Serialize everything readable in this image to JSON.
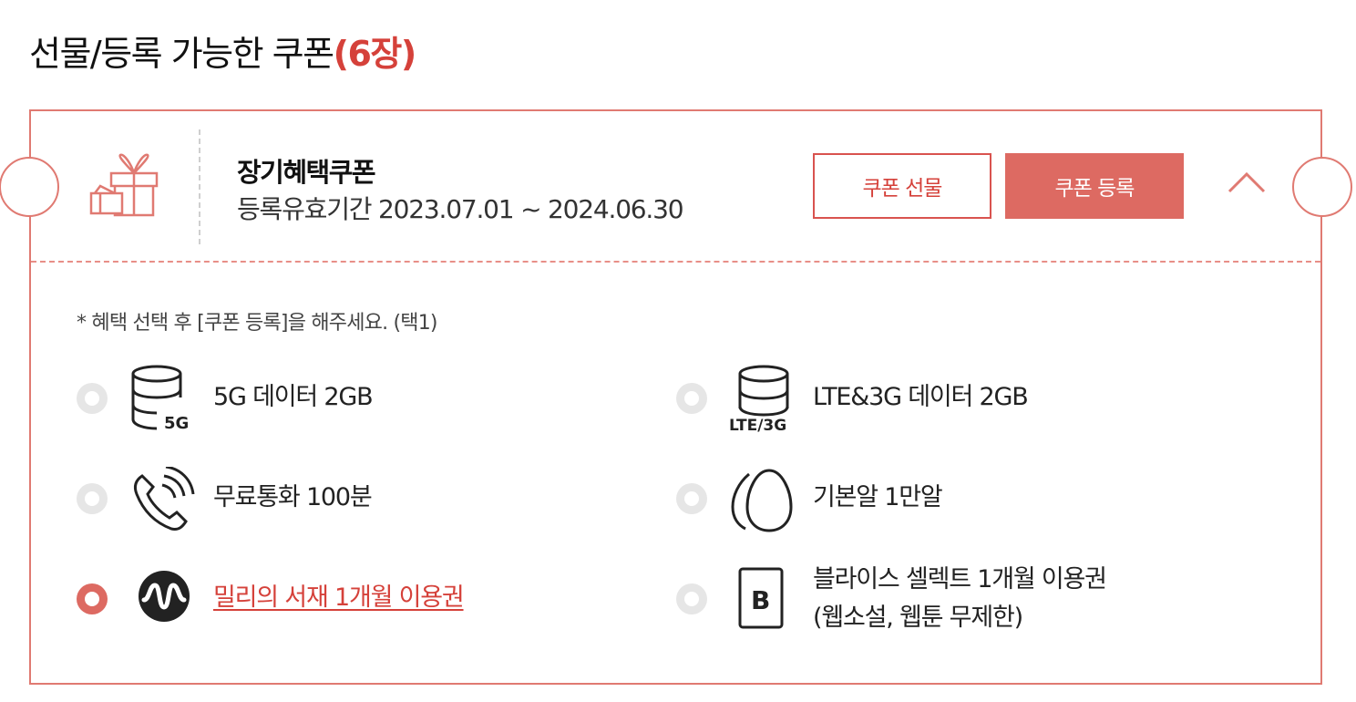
{
  "header": {
    "title": "선물/등록 가능한 쿠폰",
    "count": "(6장)"
  },
  "coupon": {
    "name": "장기혜택쿠폰",
    "period": "등록유효기간 2023.07.01 ~ 2024.06.30",
    "gift_button": "쿠폰 선물",
    "register_button": "쿠폰 등록",
    "notice": "*  혜택 선택 후 [쿠폰 등록]을 해주세요. (택1)",
    "options": [
      {
        "label": "5G 데이터 2GB",
        "icon": "5g-data-icon",
        "icon_text": "5G",
        "selected": false
      },
      {
        "label": "LTE&3G 데이터 2GB",
        "icon": "lte-3g-data-icon",
        "icon_text": "LTE/3G",
        "selected": false
      },
      {
        "label": "무료통화 100분",
        "icon": "phone-call-icon",
        "selected": false
      },
      {
        "label": "기본알 1만알",
        "icon": "egg-icon",
        "selected": false
      },
      {
        "label": "밀리의 서재 1개월 이용권",
        "icon": "millie-logo-icon",
        "selected": true
      },
      {
        "label": "블라이스 셀렉트 1개월 이용권",
        "label2": "(웹소설, 웹툰 무제한)",
        "icon": "blice-logo-icon",
        "icon_text": "B",
        "selected": false
      }
    ]
  },
  "colors": {
    "accent": "#dd6a62",
    "accent_text": "#d5413a",
    "border": "#e07a72"
  }
}
